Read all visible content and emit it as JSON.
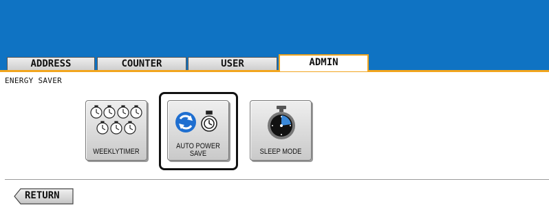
{
  "tabs": [
    {
      "label": "ADDRESS"
    },
    {
      "label": "COUNTER"
    },
    {
      "label": "USER"
    },
    {
      "label": "ADMIN",
      "active": true
    }
  ],
  "section": {
    "title": "ENERGY SAVER"
  },
  "buttons": [
    {
      "label": "WEEKLYTIMER",
      "icon": "weekly-timer-icon"
    },
    {
      "label_line1": "AUTO POWER",
      "label_line2": "SAVE",
      "icon": "auto-power-save-icon",
      "selected": true
    },
    {
      "label": "SLEEP MODE",
      "icon": "sleep-mode-icon"
    }
  ],
  "footer": {
    "return_label": "RETURN"
  },
  "colors": {
    "header_blue": "#0f73c3",
    "active_tab_accent": "#f2a51d"
  }
}
